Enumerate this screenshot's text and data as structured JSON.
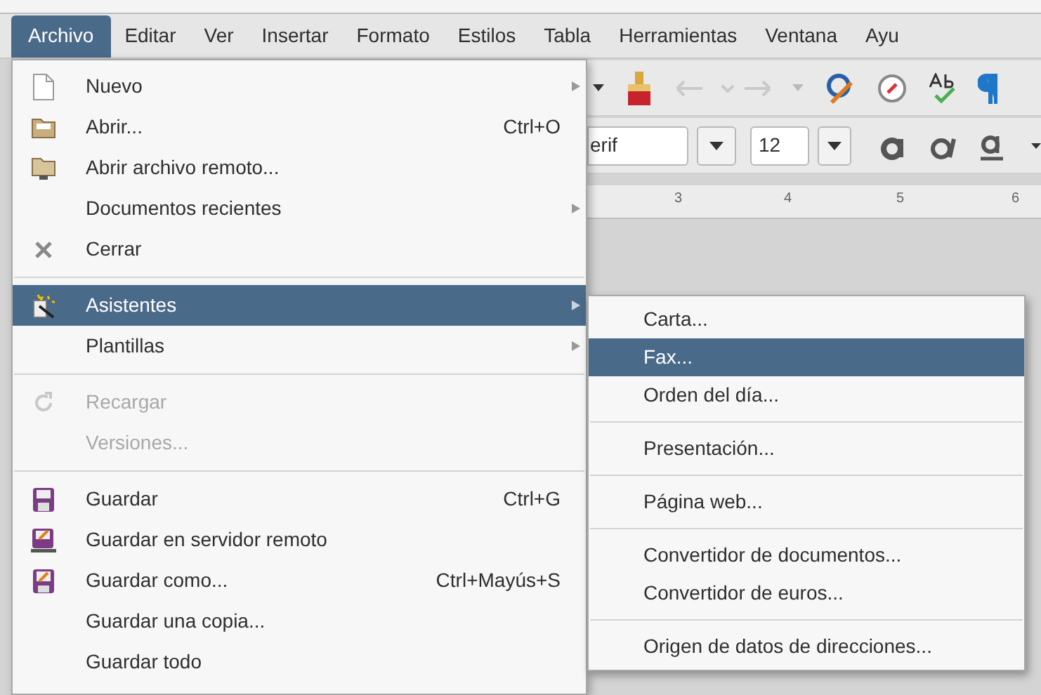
{
  "menubar": [
    {
      "label": "Archivo",
      "selected": true
    },
    {
      "label": "Editar",
      "selected": false
    },
    {
      "label": "Ver",
      "selected": false
    },
    {
      "label": "Insertar",
      "selected": false
    },
    {
      "label": "Formato",
      "selected": false
    },
    {
      "label": "Estilos",
      "selected": false
    },
    {
      "label": "Tabla",
      "selected": false
    },
    {
      "label": "Herramientas",
      "selected": false
    },
    {
      "label": "Ventana",
      "selected": false
    },
    {
      "label": "Ayu",
      "selected": false
    }
  ],
  "toolbar": {
    "font_name": "erif",
    "font_size": "12"
  },
  "ruler": [
    "3",
    "4",
    "5",
    "6"
  ],
  "file_menu": [
    {
      "kind": "item",
      "label": "Nuevo",
      "submenu": true,
      "disabled": false,
      "selected": false
    },
    {
      "kind": "item",
      "label": "Abrir...",
      "shortcut": "Ctrl+O",
      "submenu": false,
      "disabled": false,
      "selected": false
    },
    {
      "kind": "item",
      "label": "Abrir archivo remoto...",
      "submenu": false,
      "disabled": false,
      "selected": false
    },
    {
      "kind": "item",
      "label": "Documentos recientes",
      "submenu": true,
      "disabled": false,
      "selected": false
    },
    {
      "kind": "item",
      "label": "Cerrar",
      "submenu": false,
      "disabled": false,
      "selected": false
    },
    {
      "kind": "separator"
    },
    {
      "kind": "item",
      "label": "Asistentes",
      "submenu": true,
      "disabled": false,
      "selected": true
    },
    {
      "kind": "item",
      "label": "Plantillas",
      "submenu": true,
      "disabled": false,
      "selected": false
    },
    {
      "kind": "separator"
    },
    {
      "kind": "item",
      "label": "Recargar",
      "submenu": false,
      "disabled": true,
      "selected": false
    },
    {
      "kind": "item",
      "label": "Versiones...",
      "submenu": false,
      "disabled": true,
      "selected": false
    },
    {
      "kind": "separator"
    },
    {
      "kind": "item",
      "label": "Guardar",
      "shortcut": "Ctrl+G",
      "submenu": false,
      "disabled": false,
      "selected": false
    },
    {
      "kind": "item",
      "label": "Guardar en servidor remoto",
      "submenu": false,
      "disabled": false,
      "selected": false
    },
    {
      "kind": "item",
      "label": "Guardar como...",
      "shortcut": "Ctrl+Mayús+S",
      "submenu": false,
      "disabled": false,
      "selected": false
    },
    {
      "kind": "item",
      "label": "Guardar una copia...",
      "submenu": false,
      "disabled": false,
      "selected": false
    },
    {
      "kind": "item",
      "label": "Guardar todo",
      "submenu": false,
      "disabled": false,
      "selected": false
    }
  ],
  "wizards_submenu": [
    {
      "kind": "item",
      "label": "Carta...",
      "selected": false
    },
    {
      "kind": "item",
      "label": "Fax...",
      "selected": true
    },
    {
      "kind": "item",
      "label": "Orden del día...",
      "selected": false
    },
    {
      "kind": "separator"
    },
    {
      "kind": "item",
      "label": "Presentación...",
      "selected": false
    },
    {
      "kind": "separator"
    },
    {
      "kind": "item",
      "label": "Página web...",
      "selected": false
    },
    {
      "kind": "separator"
    },
    {
      "kind": "item",
      "label": "Convertidor de documentos...",
      "selected": false
    },
    {
      "kind": "item",
      "label": "Convertidor de euros...",
      "selected": false
    },
    {
      "kind": "separator"
    },
    {
      "kind": "item",
      "label": "Origen de datos de direcciones...",
      "selected": false
    }
  ]
}
